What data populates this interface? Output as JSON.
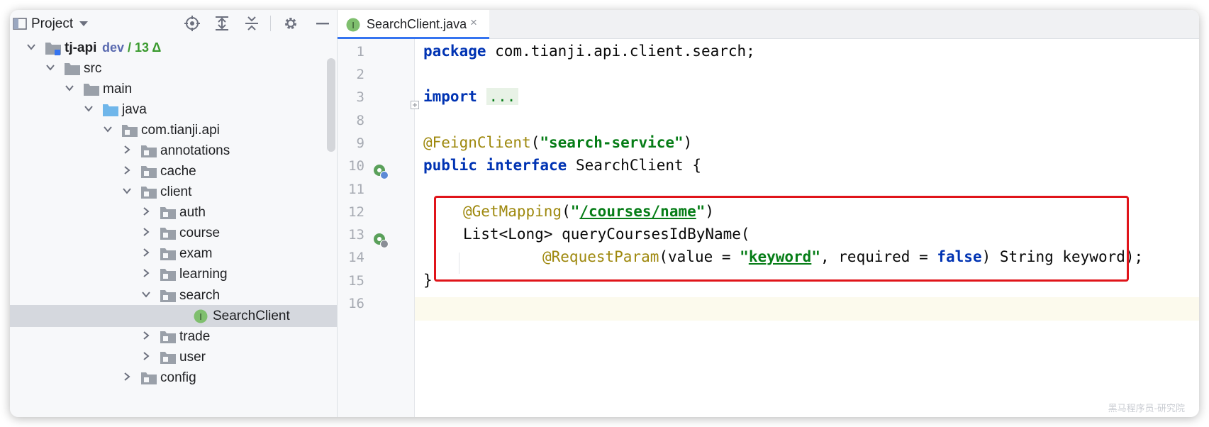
{
  "project_panel": {
    "title": "Project",
    "tree": [
      {
        "label": "tj-api",
        "branch": "dev",
        "changes": "/ 13 Δ",
        "depth": 0,
        "expanded": true,
        "icon": "module-folder-icon"
      },
      {
        "label": "src",
        "depth": 1,
        "expanded": true,
        "icon": "folder-icon"
      },
      {
        "label": "main",
        "depth": 2,
        "expanded": true,
        "icon": "folder-icon"
      },
      {
        "label": "java",
        "depth": 3,
        "expanded": true,
        "icon": "source-folder-icon"
      },
      {
        "label": "com.tianji.api",
        "depth": 4,
        "expanded": true,
        "icon": "package-icon"
      },
      {
        "label": "annotations",
        "depth": 5,
        "expanded": false,
        "icon": "package-icon"
      },
      {
        "label": "cache",
        "depth": 5,
        "expanded": false,
        "icon": "package-icon"
      },
      {
        "label": "client",
        "depth": 5,
        "expanded": true,
        "icon": "package-icon"
      },
      {
        "label": "auth",
        "depth": 6,
        "expanded": false,
        "icon": "package-icon"
      },
      {
        "label": "course",
        "depth": 6,
        "expanded": false,
        "icon": "package-icon"
      },
      {
        "label": "exam",
        "depth": 6,
        "expanded": false,
        "icon": "package-icon"
      },
      {
        "label": "learning",
        "depth": 6,
        "expanded": false,
        "icon": "package-icon"
      },
      {
        "label": "search",
        "depth": 6,
        "expanded": true,
        "icon": "package-icon"
      },
      {
        "label": "SearchClient",
        "depth": 7,
        "selected": true,
        "icon": "interface-icon"
      },
      {
        "label": "trade",
        "depth": 6,
        "expanded": false,
        "icon": "package-icon"
      },
      {
        "label": "user",
        "depth": 6,
        "expanded": false,
        "icon": "package-icon"
      },
      {
        "label": "config",
        "depth": 5,
        "expanded": false,
        "icon": "package-icon"
      }
    ]
  },
  "editor": {
    "tab": {
      "label": "SearchClient.java",
      "close": "×",
      "icon_letter": "I"
    },
    "line_numbers": [
      "1",
      "2",
      "3",
      "8",
      "9",
      "10",
      "11",
      "12",
      "13",
      "14",
      "15",
      "16"
    ],
    "code": {
      "l1_kw": "package",
      "l1_rest": " com.tianji.api.client.search;",
      "l3_kw": "import",
      "l3_dots": "...",
      "l9_ann": "@FeignClient",
      "l9_p1": "(",
      "l9_str": "\"search-service\"",
      "l9_p2": ")",
      "l10_kw1": "public",
      "l10_kw2": "interface",
      "l10_rest": " SearchClient {",
      "l12_ann": "@GetMapping",
      "l12_p1": "(",
      "l12_q1": "\"",
      "l12_str": "/courses/name",
      "l12_q2": "\"",
      "l12_p2": ")",
      "l13_text": "List<Long> queryCoursesIdByName(",
      "l14_ann": "@RequestParam",
      "l14_a": "(value = ",
      "l14_q1": "\"",
      "l14_str": "keyword",
      "l14_q2": "\"",
      "l14_b": ", required = ",
      "l14_kw": "false",
      "l14_c": ") String keyword);",
      "l15_text": "}"
    }
  },
  "watermark": "黑马程序员-研究院",
  "colors": {
    "accent": "#3574f0",
    "keyword": "#0033b3",
    "annotation": "#9e880d",
    "string": "#067d17",
    "highlight": "#e0141a"
  }
}
